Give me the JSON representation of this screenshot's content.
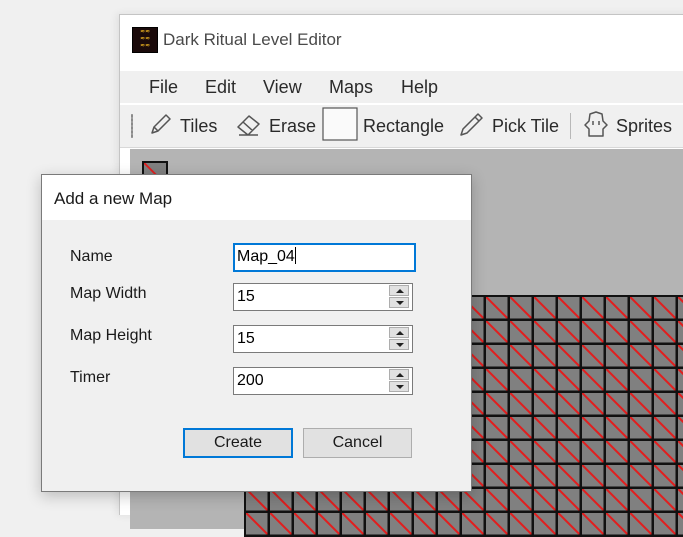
{
  "app": {
    "title": "Dark Ritual Level Editor",
    "icon": "dark-ritual-logo"
  },
  "menu": {
    "items": [
      "File",
      "Edit",
      "View",
      "Maps",
      "Help"
    ]
  },
  "toolbar": {
    "tools": [
      {
        "label": "Tiles",
        "icon": "pencil-icon"
      },
      {
        "label": "Erase",
        "icon": "eraser-icon"
      },
      {
        "label": "Rectangle",
        "icon": "rectangle-icon"
      },
      {
        "label": "Pick Tile",
        "icon": "eyedropper-icon"
      },
      {
        "label": "Sprites",
        "icon": "sprite-icon"
      }
    ]
  },
  "dialog": {
    "title": "Add a new Map",
    "fields": {
      "name": {
        "label": "Name",
        "value": "Map_04"
      },
      "width": {
        "label": "Map Width",
        "value": "15"
      },
      "height": {
        "label": "Map Height",
        "value": "15"
      },
      "timer": {
        "label": "Timer",
        "value": "200"
      }
    },
    "buttons": {
      "create": "Create",
      "cancel": "Cancel"
    }
  },
  "colors": {
    "accent": "#0078d7",
    "canvas_bg": "#b4b4b4",
    "tile_fill": "#808080",
    "tile_slash": "#e02020"
  }
}
